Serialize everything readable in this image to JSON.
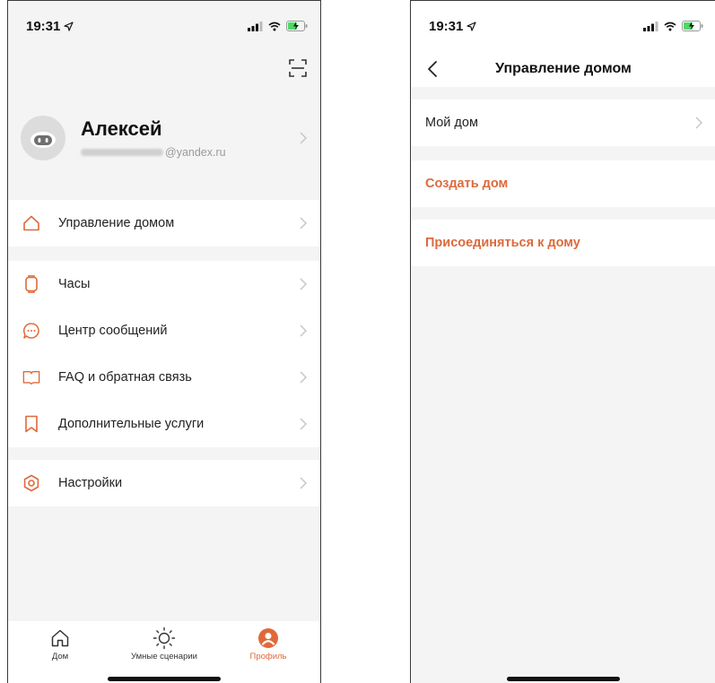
{
  "colors": {
    "accent": "#e0693a",
    "background": "#f4f4f4",
    "surface": "#ffffff"
  },
  "left": {
    "status": {
      "time": "19:31"
    },
    "header": {
      "scan_icon": "scan-icon"
    },
    "profile": {
      "name": "Алексей",
      "email_domain": "@yandex.ru"
    },
    "menu": [
      {
        "label": "Управление домом",
        "icon": "home-icon"
      },
      {
        "label": "Часы",
        "icon": "watch-icon"
      },
      {
        "label": "Центр сообщений",
        "icon": "message-icon"
      },
      {
        "label": "FAQ и обратная связь",
        "icon": "book-icon"
      },
      {
        "label": "Дополнительные услуги",
        "icon": "bookmark-icon"
      },
      {
        "label": "Настройки",
        "icon": "settings-icon"
      }
    ],
    "tabbar": {
      "tabs": [
        {
          "label": "Дом",
          "icon": "home-icon",
          "active": false
        },
        {
          "label": "Умные сценарии",
          "icon": "sun-icon",
          "active": false
        },
        {
          "label": "Профиль",
          "icon": "profile-icon",
          "active": true
        }
      ]
    }
  },
  "right": {
    "status": {
      "time": "19:31"
    },
    "nav": {
      "title": "Управление домом"
    },
    "items": [
      {
        "label": "Мой дом"
      },
      {
        "label": "Создать дом"
      },
      {
        "label": "Присоединяться к дому"
      }
    ]
  }
}
